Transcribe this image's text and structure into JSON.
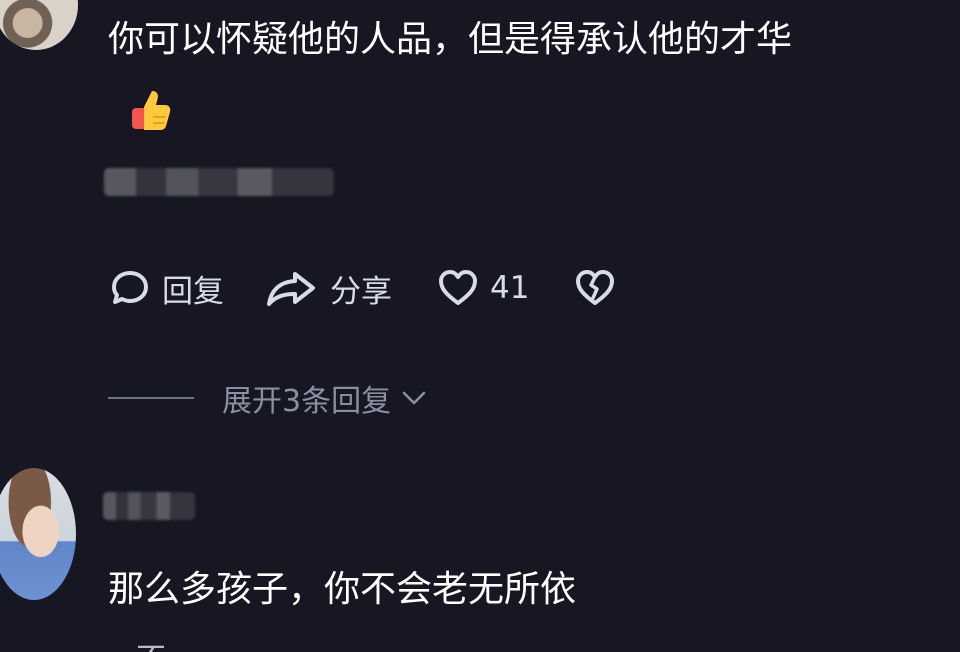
{
  "comments": [
    {
      "text": "你可以怀疑他的人品，但是得承认他的才华",
      "emoji": "thumbs-up-icon",
      "actions": {
        "reply": "回复",
        "share": "分享",
        "likes": "41"
      },
      "expand_replies": "展开3条回复"
    },
    {
      "text": "那么多孩子，你不会老无所依",
      "partial_next_line": "…不…"
    }
  ],
  "colors": {
    "background": "#161722",
    "text": "#ffffff",
    "secondary": "#8c8fa0"
  }
}
